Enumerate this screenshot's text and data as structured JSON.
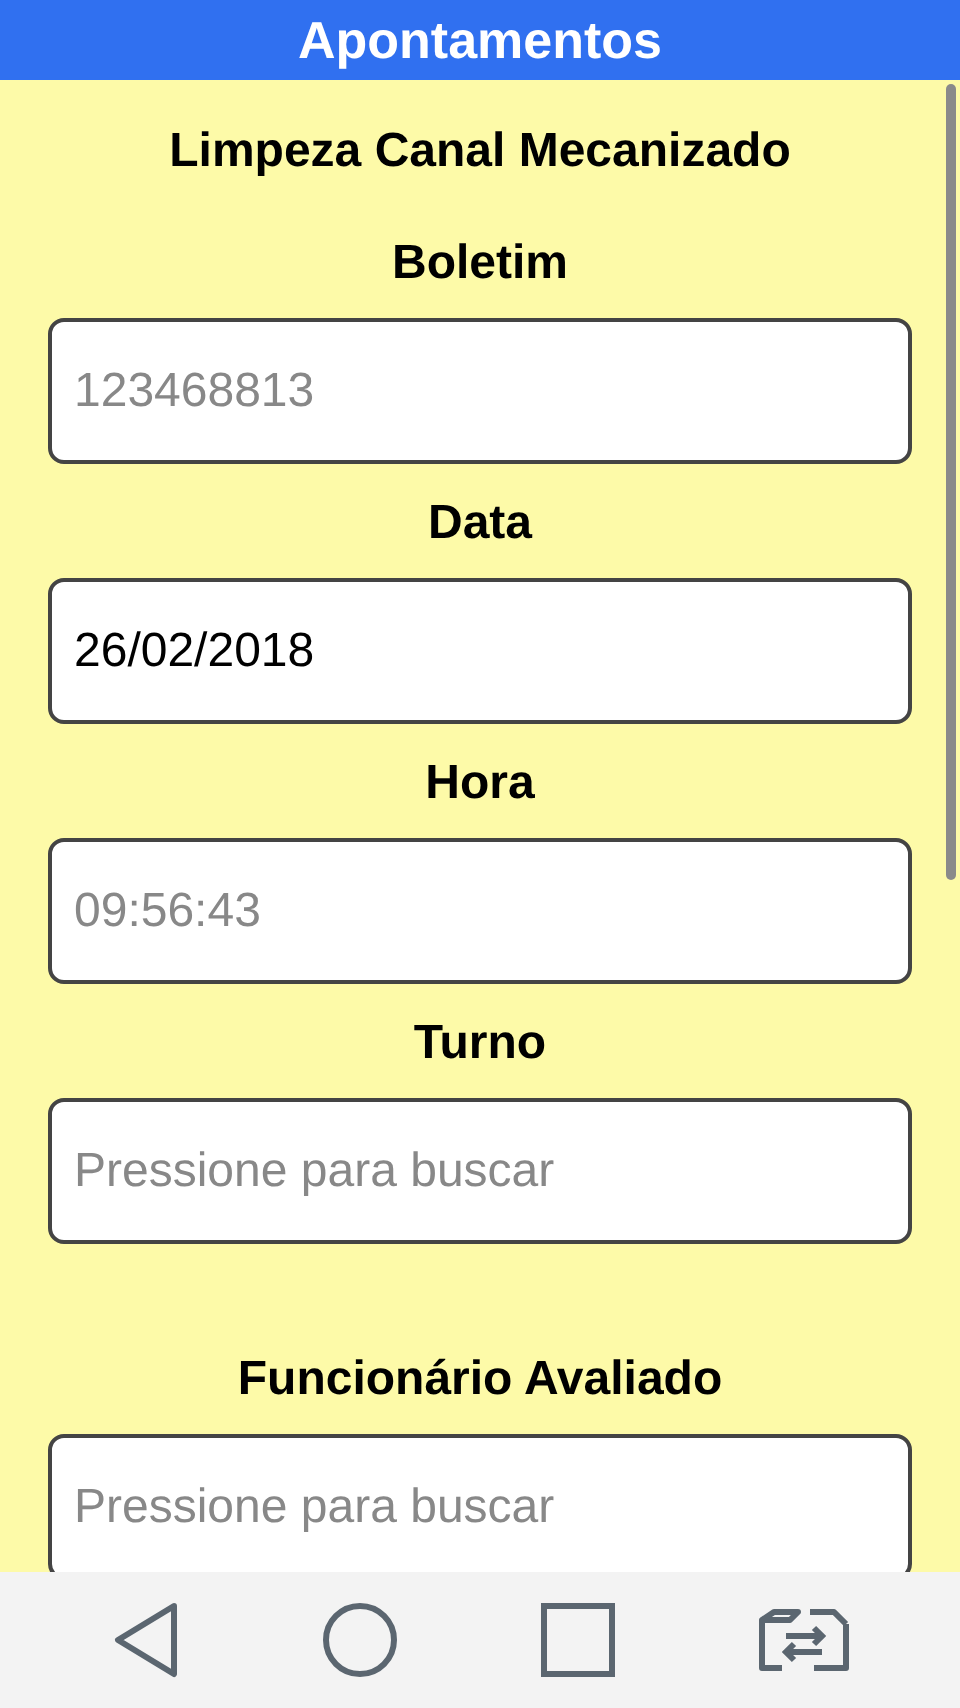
{
  "header": {
    "title": "Apontamentos"
  },
  "form_title": "Limpeza Canal Mecanizado",
  "fields": [
    {
      "label": "Boletim",
      "value": "123468813",
      "disabled": true
    },
    {
      "label": "Data",
      "value": "26/02/2018",
      "disabled": false
    },
    {
      "label": "Hora",
      "value": "09:56:43",
      "disabled": true
    },
    {
      "label": "Turno",
      "placeholder": "Pressione para buscar"
    },
    {
      "label": "Funcionário Avaliado",
      "placeholder": "Pressione para buscar"
    }
  ]
}
